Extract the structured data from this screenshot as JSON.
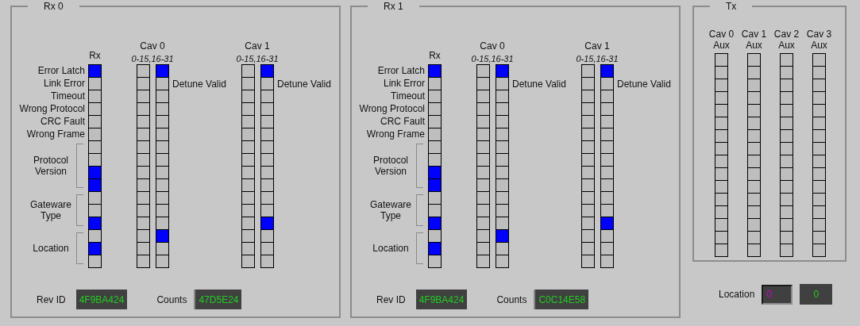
{
  "rx_panels": [
    {
      "title": "Rx 0",
      "rx_header": "Rx",
      "fields": [
        {
          "kind": "flag",
          "label": "Error Latch",
          "leds": [
            true
          ]
        },
        {
          "kind": "flag",
          "label": "Link Error",
          "leds": [
            false
          ]
        },
        {
          "kind": "flag",
          "label": "Timeout",
          "leds": [
            false
          ]
        },
        {
          "kind": "flag",
          "label": "Wrong Protocol",
          "leds": [
            false
          ]
        },
        {
          "kind": "flag",
          "label": "CRC Fault",
          "leds": [
            false
          ]
        },
        {
          "kind": "flag",
          "label": "Wrong Frame",
          "leds": [
            false
          ]
        },
        {
          "kind": "group",
          "label": "Protocol Version",
          "leds": [
            false,
            false,
            true,
            true
          ]
        },
        {
          "kind": "group",
          "label": "Gateware Type",
          "leds": [
            false,
            false,
            true
          ]
        },
        {
          "kind": "group",
          "label": "Location",
          "leds": [
            false,
            true,
            false
          ]
        }
      ],
      "cavities": [
        {
          "title": "Cav 0",
          "subtitle": "0-15,16-31",
          "note": "Detune Valid",
          "low_leds": [
            false,
            false,
            false,
            false,
            false,
            false,
            false,
            false,
            false,
            false,
            false,
            false,
            false,
            false,
            false,
            false
          ],
          "high_leds": [
            true,
            false,
            false,
            false,
            false,
            false,
            false,
            false,
            false,
            false,
            false,
            false,
            false,
            true,
            false,
            false
          ]
        },
        {
          "title": "Cav 1",
          "subtitle": "0-15,16-31",
          "note": "Detune Valid",
          "low_leds": [
            false,
            false,
            false,
            false,
            false,
            false,
            false,
            false,
            false,
            false,
            false,
            false,
            false,
            false,
            false,
            false
          ],
          "high_leds": [
            true,
            false,
            false,
            false,
            false,
            false,
            false,
            false,
            false,
            false,
            false,
            false,
            true,
            false,
            false,
            false
          ]
        }
      ],
      "rev_id_label": "Rev ID",
      "rev_id": "4F9BA424",
      "counts_label": "Counts",
      "counts": "47D5E24"
    },
    {
      "title": "Rx 1",
      "rx_header": "Rx",
      "fields": [
        {
          "kind": "flag",
          "label": "Error Latch",
          "leds": [
            true
          ]
        },
        {
          "kind": "flag",
          "label": "Link Error",
          "leds": [
            false
          ]
        },
        {
          "kind": "flag",
          "label": "Timeout",
          "leds": [
            false
          ]
        },
        {
          "kind": "flag",
          "label": "Wrong Protocol",
          "leds": [
            false
          ]
        },
        {
          "kind": "flag",
          "label": "CRC Fault",
          "leds": [
            false
          ]
        },
        {
          "kind": "flag",
          "label": "Wrong Frame",
          "leds": [
            false
          ]
        },
        {
          "kind": "group",
          "label": "Protocol Version",
          "leds": [
            false,
            false,
            true,
            true
          ]
        },
        {
          "kind": "group",
          "label": "Gateware Type",
          "leds": [
            false,
            false,
            true
          ]
        },
        {
          "kind": "group",
          "label": "Location",
          "leds": [
            false,
            true,
            false
          ]
        }
      ],
      "cavities": [
        {
          "title": "Cav 0",
          "subtitle": "0-15,16-31",
          "note": "Detune Valid",
          "low_leds": [
            false,
            false,
            false,
            false,
            false,
            false,
            false,
            false,
            false,
            false,
            false,
            false,
            false,
            false,
            false,
            false
          ],
          "high_leds": [
            true,
            false,
            false,
            false,
            false,
            false,
            false,
            false,
            false,
            false,
            false,
            false,
            false,
            true,
            false,
            false
          ]
        },
        {
          "title": "Cav 1",
          "subtitle": "0-15,16-31",
          "note": "Detune Valid",
          "low_leds": [
            false,
            false,
            false,
            false,
            false,
            false,
            false,
            false,
            false,
            false,
            false,
            false,
            false,
            false,
            false,
            false
          ],
          "high_leds": [
            true,
            false,
            false,
            false,
            false,
            false,
            false,
            false,
            false,
            false,
            false,
            false,
            true,
            false,
            false,
            false
          ]
        }
      ],
      "rev_id_label": "Rev ID",
      "rev_id": "4F9BA424",
      "counts_label": "Counts",
      "counts": "C0C14E58"
    }
  ],
  "tx": {
    "title": "Tx",
    "columns": [
      {
        "title": "Cav 0",
        "subtitle": "Aux",
        "leds": [
          false,
          false,
          false,
          false,
          false,
          false,
          false,
          false,
          false,
          false,
          false,
          false,
          false,
          false,
          false,
          false
        ]
      },
      {
        "title": "Cav 1",
        "subtitle": "Aux",
        "leds": [
          false,
          false,
          false,
          false,
          false,
          false,
          false,
          false,
          false,
          false,
          false,
          false,
          false,
          false,
          false,
          false
        ]
      },
      {
        "title": "Cav 2",
        "subtitle": "Aux",
        "leds": [
          false,
          false,
          false,
          false,
          false,
          false,
          false,
          false,
          false,
          false,
          false,
          false,
          false,
          false,
          false,
          false
        ]
      },
      {
        "title": "Cav 3",
        "subtitle": "Aux",
        "leds": [
          false,
          false,
          false,
          false,
          false,
          false,
          false,
          false,
          false,
          false,
          false,
          false,
          false,
          false,
          false,
          false
        ]
      }
    ]
  },
  "location": {
    "label": "Location",
    "input": "0",
    "readback": "0"
  }
}
